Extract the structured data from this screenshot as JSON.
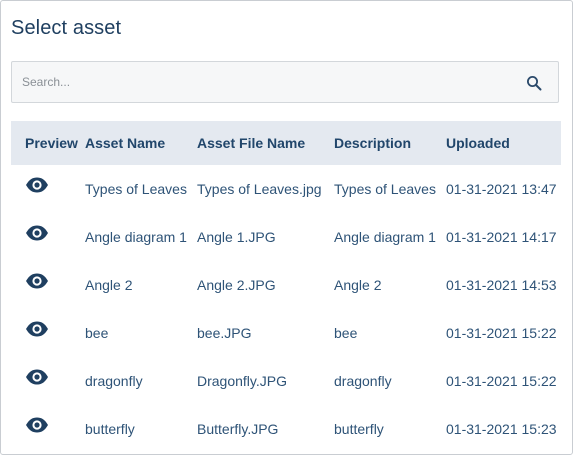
{
  "dialog": {
    "title": "Select asset"
  },
  "search": {
    "placeholder": "Search...",
    "value": "",
    "icon": "search-icon"
  },
  "table": {
    "columns": [
      "Preview",
      "Asset Name",
      "Asset File Name",
      "Description",
      "Uploaded"
    ],
    "rows": [
      {
        "preview_icon": "eye-icon",
        "asset_name": "Types of Leaves",
        "file_name": "Types of Leaves.jpg",
        "description": "Types of Leaves",
        "uploaded": "01-31-2021 13:47"
      },
      {
        "preview_icon": "eye-icon",
        "asset_name": "Angle diagram 1",
        "file_name": "Angle 1.JPG",
        "description": "Angle diagram 1",
        "uploaded": "01-31-2021 14:17"
      },
      {
        "preview_icon": "eye-icon",
        "asset_name": "Angle 2",
        "file_name": "Angle 2.JPG",
        "description": "Angle 2",
        "uploaded": "01-31-2021 14:53"
      },
      {
        "preview_icon": "eye-icon",
        "asset_name": "bee",
        "file_name": "bee.JPG",
        "description": "bee",
        "uploaded": "01-31-2021 15:22"
      },
      {
        "preview_icon": "eye-icon",
        "asset_name": "dragonfly",
        "file_name": "Dragonfly.JPG",
        "description": "dragonfly",
        "uploaded": "01-31-2021 15:22"
      },
      {
        "preview_icon": "eye-icon",
        "asset_name": "butterfly",
        "file_name": "Butterfly.JPG",
        "description": "butterfly",
        "uploaded": "01-31-2021 15:23"
      }
    ]
  },
  "colors": {
    "header_bg": "#e4e9f0",
    "text": "#2e5377",
    "title": "#1f3f60",
    "search_bg": "#f6f7f8"
  }
}
